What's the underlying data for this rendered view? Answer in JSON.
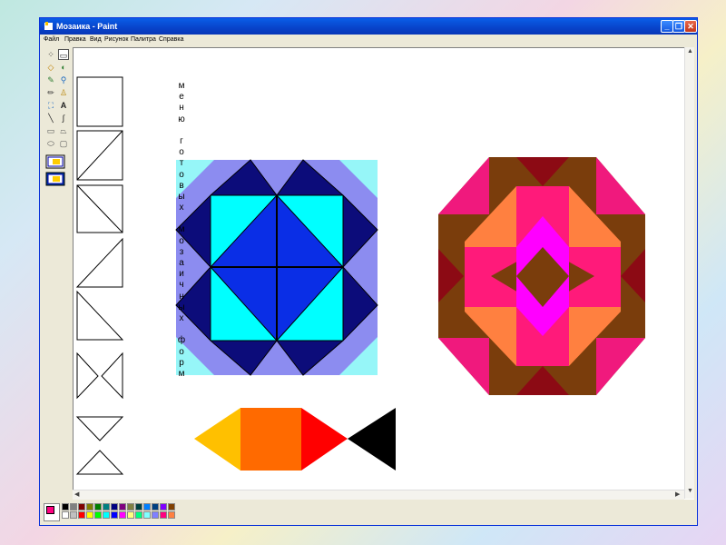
{
  "window": {
    "title": "Мозаика - Paint",
    "minimize_symbol": "_",
    "maximize_symbol": "❐",
    "close_symbol": "✕"
  },
  "menu": [
    "Файл",
    "Правка",
    "Вид",
    "Рисунок",
    "Палитра",
    "Справка"
  ],
  "tools": [
    {
      "icon": "free-select-icon",
      "glyph": "⁘"
    },
    {
      "icon": "rect-select-icon",
      "glyph": "▭"
    },
    {
      "icon": "eraser-icon",
      "glyph": "◇"
    },
    {
      "icon": "fill-bucket-icon",
      "glyph": "◐"
    },
    {
      "icon": "color-picker-icon",
      "glyph": "✎"
    },
    {
      "icon": "magnifier-icon",
      "glyph": "⚲"
    },
    {
      "icon": "pencil-icon",
      "glyph": "✏"
    },
    {
      "icon": "brush-icon",
      "glyph": "♙"
    },
    {
      "icon": "airbrush-icon",
      "glyph": "⛶"
    },
    {
      "icon": "text-icon",
      "glyph": "A"
    },
    {
      "icon": "line-icon",
      "glyph": "╲"
    },
    {
      "icon": "curve-icon",
      "glyph": "∫"
    },
    {
      "icon": "rectangle-icon",
      "glyph": "▭"
    },
    {
      "icon": "polygon-icon",
      "glyph": "⏢"
    },
    {
      "icon": "ellipse-icon",
      "glyph": "⬭"
    },
    {
      "icon": "rounded-rect-icon",
      "glyph": "▢"
    }
  ],
  "vertical_label": [
    "м",
    "е",
    "н",
    "ю",
    " ",
    "г",
    "о",
    "т",
    "о",
    "в",
    "ы",
    "х",
    " ",
    "м",
    "о",
    "з",
    "а",
    "и",
    "ч",
    "н",
    "ы",
    "х",
    " ",
    "ф",
    "о",
    "р",
    "м"
  ],
  "colors": {
    "title_bar": "#0843c9",
    "cyan": "#00ffff",
    "light_cyan": "#96f6f8",
    "periwinkle": "#8c8cf0",
    "navy": "#0c0c7a",
    "blue": "#0a2ee6",
    "pink": "#f0197d",
    "brown": "#7a3d0c",
    "peach": "#ff8040",
    "dark_red": "#8c0a14",
    "magenta": "#ff00ff",
    "hot_pink": "#ff1a7a",
    "yellow": "#ffc000",
    "orange": "#ff6a00",
    "red": "#ff0000",
    "black": "#000000"
  },
  "palette_top": [
    "#000000",
    "#808080",
    "#800000",
    "#808000",
    "#008000",
    "#008080",
    "#000080",
    "#800080",
    "#808040",
    "#004040",
    "#0080ff",
    "#004080",
    "#8000ff",
    "#804000"
  ],
  "palette_bottom": [
    "#ffffff",
    "#c0c0c0",
    "#ff0000",
    "#ffff00",
    "#00ff00",
    "#00ffff",
    "#0000ff",
    "#ff00ff",
    "#ffff80",
    "#00ff80",
    "#80ffff",
    "#8080ff",
    "#ff0080",
    "#ff8040"
  ],
  "current_colors": {
    "foreground": "#ff0080",
    "background": "#ffffff"
  }
}
